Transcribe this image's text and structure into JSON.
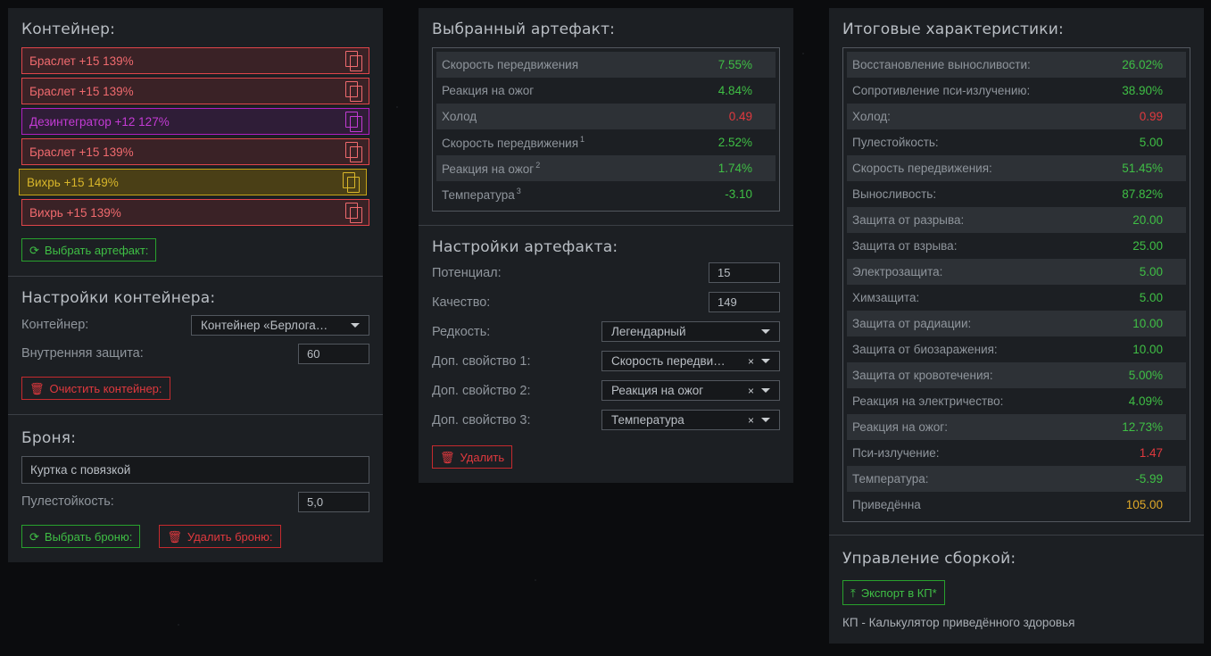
{
  "container_panel": {
    "title": "Контейнер:",
    "items": [
      {
        "label": "Браслет +15 139%",
        "rarity": "red"
      },
      {
        "label": "Браслет +15 139%",
        "rarity": "red"
      },
      {
        "label": "Дезинтегратор +12 127%",
        "rarity": "purple"
      },
      {
        "label": "Браслет +15 139%",
        "rarity": "red"
      },
      {
        "label": "Вихрь +15 149%",
        "rarity": "gold"
      },
      {
        "label": "Вихрь +15 139%",
        "rarity": "red"
      }
    ],
    "select_button": "Выбрать артефакт:"
  },
  "container_settings": {
    "title": "Настройки контейнера:",
    "container_label": "Контейнер:",
    "container_value": "Контейнер «Берлога…",
    "inner_protection_label": "Внутренняя защита:",
    "inner_protection_value": "60",
    "clear_button": "Очистить контейнер:"
  },
  "armor": {
    "title": "Броня:",
    "name_value": "Куртка с повязкой",
    "bullet_label": "Пулестойкость:",
    "bullet_value": "5,0",
    "select_button": "Выбрать броню:",
    "delete_button": "Удалить броню:"
  },
  "selected_artifact": {
    "title": "Выбранный артефакт:",
    "stats": [
      {
        "label": "Скорость передвижения",
        "sup": "",
        "value": "7.55%",
        "tone": "pos"
      },
      {
        "label": "Реакция на ожог",
        "sup": "",
        "value": "4.84%",
        "tone": "pos"
      },
      {
        "label": "Холод",
        "sup": "",
        "value": "0.49",
        "tone": "neg"
      },
      {
        "label": "Скорость передвижения",
        "sup": "1",
        "value": "2.52%",
        "tone": "pos"
      },
      {
        "label": "Реакция на ожог",
        "sup": "2",
        "value": "1.74%",
        "tone": "pos"
      },
      {
        "label": "Температура",
        "sup": "3",
        "value": "-3.10",
        "tone": "pos"
      }
    ]
  },
  "artifact_settings": {
    "title": "Настройки артефакта:",
    "potential_label": "Потенциал:",
    "potential_value": "15",
    "quality_label": "Качество:",
    "quality_value": "149",
    "rarity_label": "Редкость:",
    "rarity_value": "Легендарный",
    "extra1_label": "Доп. свойство 1:",
    "extra1_value": "Скорость передви…",
    "extra2_label": "Доп. свойство 2:",
    "extra2_value": "Реакция на ожог",
    "extra3_label": "Доп. свойство 3:",
    "extra3_value": "Температура",
    "clear_symbol": "×",
    "delete_button": "Удалить"
  },
  "totals": {
    "title": "Итоговые характеристики:",
    "stats": [
      {
        "label": "Восстановление выносливости:",
        "value": "26.02%",
        "tone": "pos"
      },
      {
        "label": "Сопротивление пси-излучению:",
        "value": "38.90%",
        "tone": "pos"
      },
      {
        "label": "Холод:",
        "value": "0.99",
        "tone": "neg"
      },
      {
        "label": "Пулестойкость:",
        "value": "5.00",
        "tone": "pos"
      },
      {
        "label": "Скорость передвижения:",
        "value": "51.45%",
        "tone": "pos"
      },
      {
        "label": "Выносливость:",
        "value": "87.82%",
        "tone": "pos"
      },
      {
        "label": "Защита от разрыва:",
        "value": "20.00",
        "tone": "pos"
      },
      {
        "label": "Защита от взрыва:",
        "value": "25.00",
        "tone": "pos"
      },
      {
        "label": "Электрозащита:",
        "value": "5.00",
        "tone": "pos"
      },
      {
        "label": "Химзащита:",
        "value": "5.00",
        "tone": "pos"
      },
      {
        "label": "Защита от радиации:",
        "value": "10.00",
        "tone": "pos"
      },
      {
        "label": "Защита от биозаражения:",
        "value": "10.00",
        "tone": "pos"
      },
      {
        "label": "Защита от кровотечения:",
        "value": "5.00%",
        "tone": "pos"
      },
      {
        "label": "Реакция на электричество:",
        "value": "4.09%",
        "tone": "pos"
      },
      {
        "label": "Реакция на ожог:",
        "value": "12.73%",
        "tone": "pos"
      },
      {
        "label": "Пси-излучение:",
        "value": "1.47",
        "tone": "neg"
      },
      {
        "label": "Температура:",
        "value": "-5.99",
        "tone": "pos"
      },
      {
        "label": "Приведённа",
        "value": "105.00",
        "tone": "gold"
      }
    ]
  },
  "build": {
    "title": "Управление сборкой:",
    "export_button": "Экспорт в КП*",
    "note": "КП - Калькулятор приведённого здоровья"
  }
}
